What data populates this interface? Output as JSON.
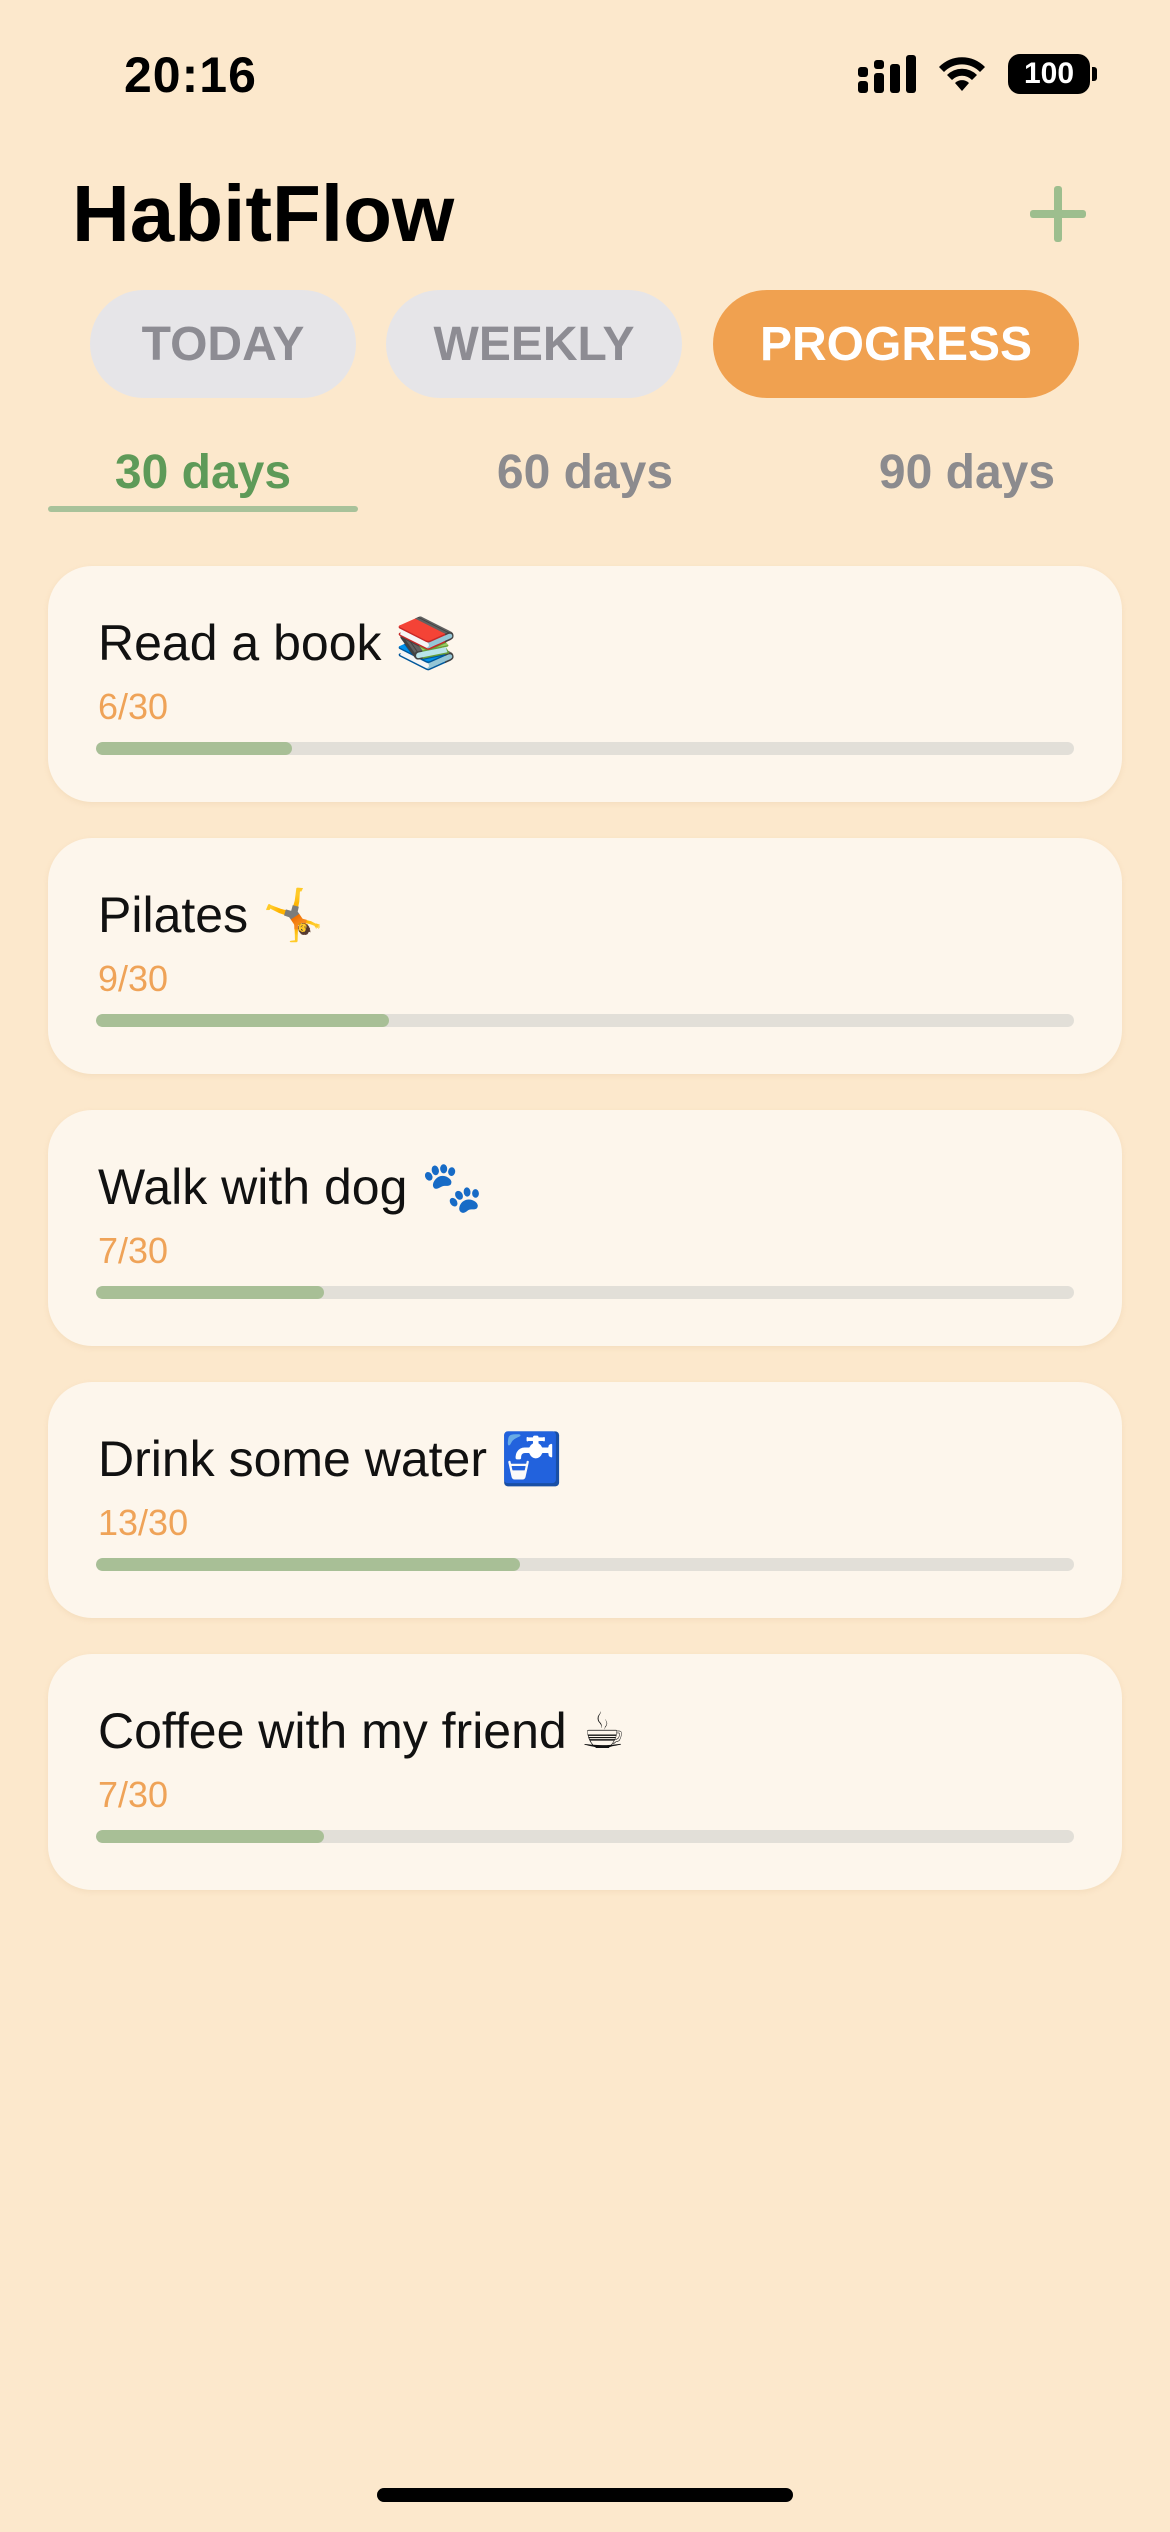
{
  "status_bar": {
    "time": "20:16",
    "battery": "100",
    "icons": [
      "signal-icon",
      "wifi-icon",
      "battery-icon"
    ]
  },
  "header": {
    "title": "HabitFlow",
    "add_icon": "plus-icon"
  },
  "segments": [
    {
      "label": "TODAY",
      "active": false
    },
    {
      "label": "WEEKLY",
      "active": false
    },
    {
      "label": "PROGRESS",
      "active": true
    }
  ],
  "range_tabs": [
    {
      "label": "30 days",
      "active": true
    },
    {
      "label": "60 days",
      "active": false
    },
    {
      "label": "90 days",
      "active": false
    }
  ],
  "habits": [
    {
      "name": "Read a book 📚",
      "count": "6/30",
      "done": 6,
      "total": 30
    },
    {
      "name": "Pilates 🤸",
      "count": "9/30",
      "done": 9,
      "total": 30
    },
    {
      "name": "Walk with dog 🐾",
      "count": "7/30",
      "done": 7,
      "total": 30
    },
    {
      "name": "Drink some water 🚰",
      "count": "13/30",
      "done": 13,
      "total": 30
    },
    {
      "name": "Coffee with my friend ☕",
      "count": "7/30",
      "done": 7,
      "total": 30
    }
  ],
  "colors": {
    "background": "#FCE8CC",
    "accent_orange": "#F0A150",
    "accent_green": "#5E9A58",
    "progress_fill": "#A8BF96"
  }
}
